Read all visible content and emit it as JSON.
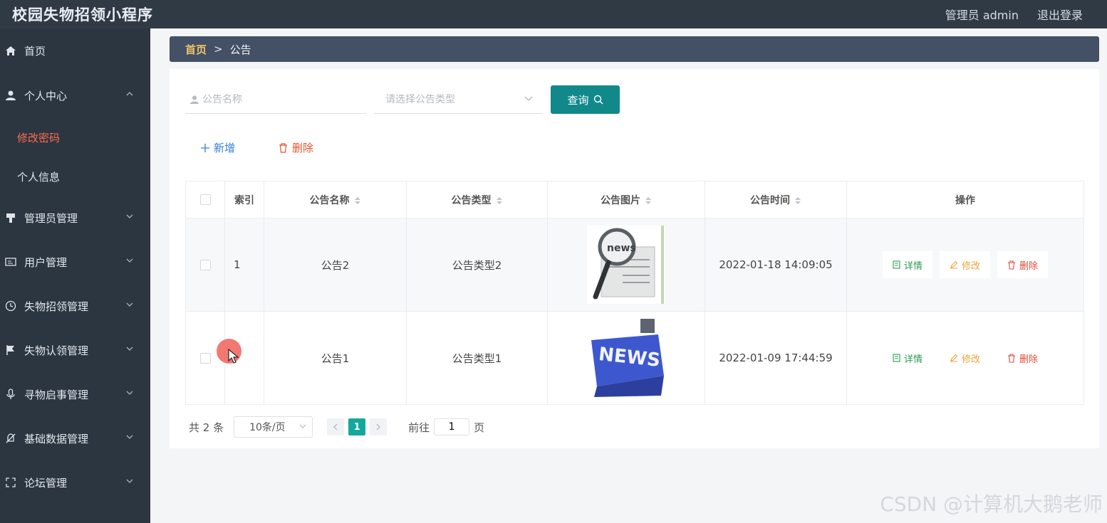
{
  "header": {
    "app_title": "校园失物招领小程序",
    "user_label": "管理员 admin",
    "logout_label": "退出登录"
  },
  "sidebar": {
    "items": [
      {
        "label": "首页",
        "icon": "home-icon"
      },
      {
        "label": "个人中心",
        "icon": "user-icon",
        "expanded": true,
        "children": [
          {
            "label": "修改密码",
            "active": true
          },
          {
            "label": "个人信息"
          }
        ]
      },
      {
        "label": "管理员管理",
        "icon": "admin-icon"
      },
      {
        "label": "用户管理",
        "icon": "id-card-icon"
      },
      {
        "label": "失物招领管理",
        "icon": "clock-icon"
      },
      {
        "label": "失物认领管理",
        "icon": "flag-icon"
      },
      {
        "label": "寻物启事管理",
        "icon": "microphone-icon"
      },
      {
        "label": "基础数据管理",
        "icon": "bell-off-icon"
      },
      {
        "label": "论坛管理",
        "icon": "fullscreen-icon"
      }
    ]
  },
  "breadcrumb": {
    "home": "首页",
    "separator": ">",
    "current": "公告"
  },
  "search": {
    "name_placeholder": "公告名称",
    "type_placeholder": "请选择公告类型",
    "query_label": "查询"
  },
  "actions": {
    "add_label": "新增",
    "delete_label": "删除"
  },
  "table": {
    "columns": [
      "索引",
      "公告名称",
      "公告类型",
      "公告图片",
      "公告时间",
      "操作"
    ],
    "rows": [
      {
        "index": "1",
        "name": "公告2",
        "type": "公告类型2",
        "image": "newspaper-magnifier-image",
        "time": "2022-01-18 14:09:05"
      },
      {
        "index": "",
        "name": "公告1",
        "type": "公告类型1",
        "image": "news-key-image",
        "time": "2022-01-09 17:44:59"
      }
    ],
    "op_labels": {
      "detail": "详情",
      "edit": "修改",
      "remove": "删除"
    },
    "news_key_text": "NEWS",
    "news_paper_text": "news"
  },
  "pagination": {
    "total_text": "共 2 条",
    "page_size": "10条/页",
    "current_page": "1",
    "goto_prefix": "前往",
    "goto_value": "1",
    "goto_suffix": "页"
  },
  "watermark": "CSDN @计算机大鹅老师",
  "colors": {
    "topbar": "#2f3a45",
    "sidebar": "#2b3641",
    "breadcrumb_bg": "#435065",
    "accent_teal": "#11898a",
    "active_menu": "#ff6b4a"
  }
}
